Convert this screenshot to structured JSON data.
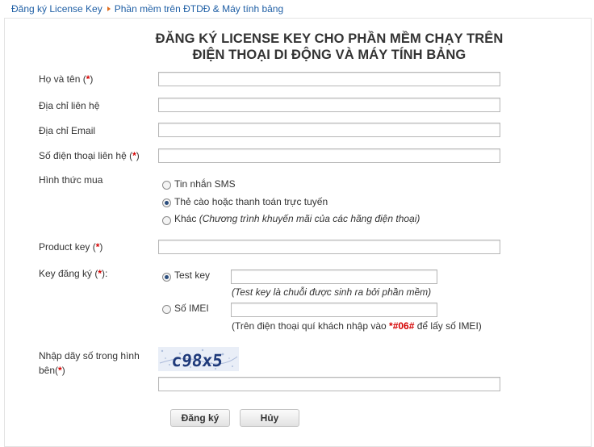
{
  "breadcrumb": {
    "item1": "Đăng ký License Key",
    "item2": "Phần mềm trên ĐTDĐ & Máy tính bảng"
  },
  "title": {
    "line1": "ĐĂNG KÝ LICENSE KEY CHO PHẦN MỀM CHẠY TRÊN",
    "line2": "ĐIỆN THOẠI DI ĐỘNG VÀ MÁY TÍNH BẢNG"
  },
  "form": {
    "fullname_label": "Họ và tên (",
    "address_label": "Địa chỉ liên hệ",
    "email_label": "Địa chỉ Email",
    "phone_label": "Số điện thoại liên hệ (",
    "purchase_label": "Hình thức mua",
    "purchase_options": [
      {
        "label": "Tin nhắn SMS",
        "selected": false
      },
      {
        "label": "Thẻ cào hoặc thanh toán trực tuyến",
        "selected": true
      },
      {
        "label": "Khác",
        "hint": "(Chương trình khuyến mãi của các hãng điện thoại)",
        "selected": false
      }
    ],
    "product_key_label": "Product key (",
    "register_key_label": "Key đăng ký (",
    "register_key_suffix": "):",
    "key_options": [
      {
        "label": "Test key",
        "selected": true,
        "note": "(Test key là chuỗi được sinh ra bởi phần mềm)"
      },
      {
        "label": "Số IMEI",
        "selected": false,
        "note_prefix": "(Trên điện thoại quí khách nhập vào ",
        "note_code": "*#06#",
        "note_suffix": " để lấy số IMEI)"
      }
    ],
    "captcha_label_line1": "Nhập dãy số trong hình",
    "captcha_label_line2": "bên(",
    "captcha_text": "c98x5",
    "required_mark": "*",
    "close_paren": ")"
  },
  "buttons": {
    "submit": "Đăng ký",
    "cancel": "Hủy"
  },
  "colors": {
    "link": "#1f5fa5",
    "required": "#d40000",
    "breadcrumb_arrow": "#e06d1e",
    "captcha_text": "#1f3a7a"
  }
}
